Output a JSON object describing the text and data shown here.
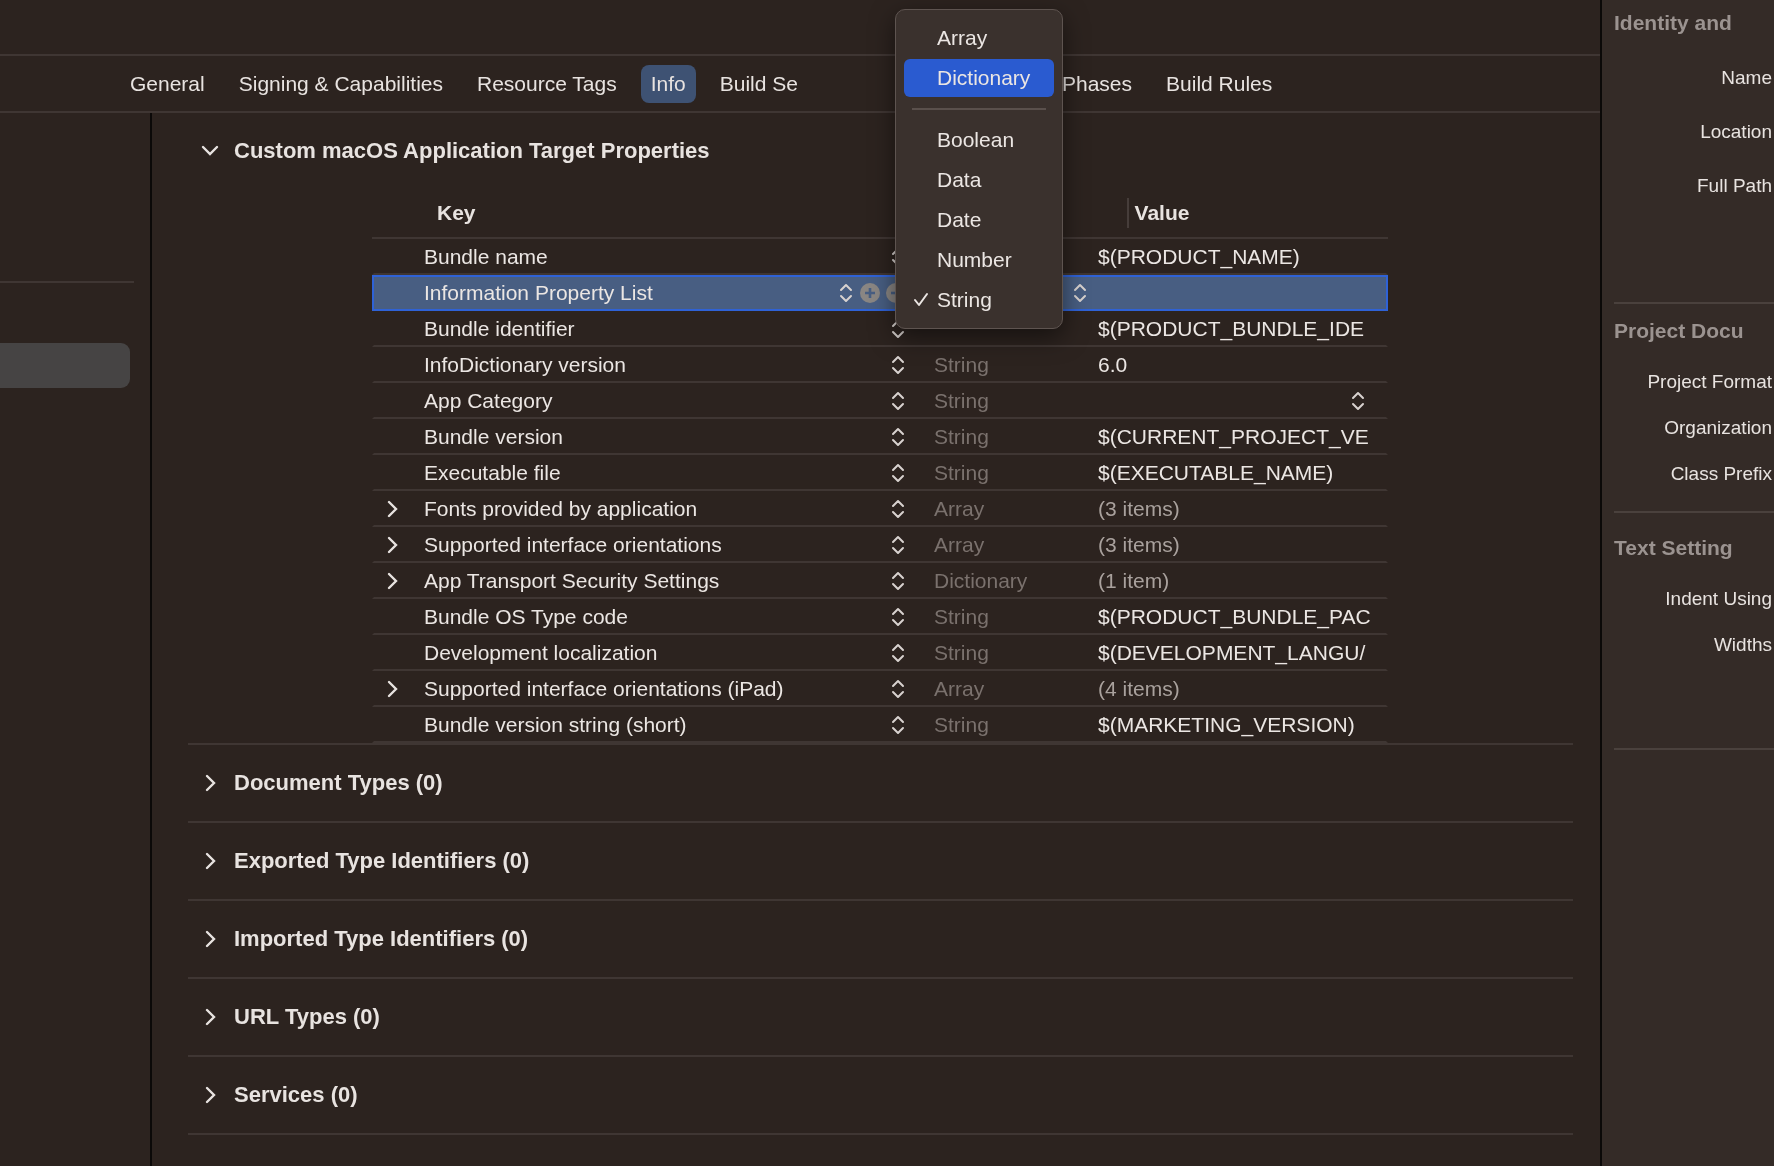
{
  "tabs": [
    {
      "label": "General",
      "selected": false
    },
    {
      "label": "Signing & Capabilities",
      "selected": false
    },
    {
      "label": "Resource Tags",
      "selected": false
    },
    {
      "label": "Info",
      "selected": true
    },
    {
      "label": "Build Se",
      "selected": false
    },
    {
      "label": "Phases",
      "selected": false
    },
    {
      "label": "Build Rules",
      "selected": false
    }
  ],
  "section": {
    "title": "Custom macOS Application Target Properties",
    "expanded": true
  },
  "table": {
    "columns": [
      "Key",
      "Value"
    ],
    "rows": [
      {
        "key": "Bundle name",
        "value": "$(PRODUCT_NAME)",
        "selected": false,
        "expandable": false
      },
      {
        "key": "Information Property List",
        "selected": true,
        "expandable": false
      },
      {
        "key": "Bundle identifier",
        "value": "$(PRODUCT_BUNDLE_IDE",
        "selected": false,
        "expandable": false
      },
      {
        "key": "InfoDictionary version",
        "type": "String",
        "value": "6.0",
        "selected": false,
        "expandable": false
      },
      {
        "key": "App Category",
        "type": "String",
        "selected": false,
        "expandable": false,
        "value_popup": true
      },
      {
        "key": "Bundle version",
        "type": "String",
        "value": "$(CURRENT_PROJECT_VE",
        "selected": false,
        "expandable": false
      },
      {
        "key": "Executable file",
        "type": "String",
        "value": "$(EXECUTABLE_NAME)",
        "selected": false,
        "expandable": false
      },
      {
        "key": "Fonts provided by application",
        "type": "Array",
        "value": "(3 items)",
        "selected": false,
        "expandable": true
      },
      {
        "key": "Supported interface orientations",
        "type": "Array",
        "value": "(3 items)",
        "selected": false,
        "expandable": true
      },
      {
        "key": "App Transport Security Settings",
        "type": "Dictionary",
        "value": "(1 item)",
        "selected": false,
        "expandable": true
      },
      {
        "key": "Bundle OS Type code",
        "type": "String",
        "value": "$(PRODUCT_BUNDLE_PAC",
        "selected": false,
        "expandable": false
      },
      {
        "key": "Development localization",
        "type": "String",
        "value": "$(DEVELOPMENT_LANGU/",
        "selected": false,
        "expandable": false
      },
      {
        "key": "Supported interface orientations (iPad)",
        "type": "Array",
        "value": "(4 items)",
        "selected": false,
        "expandable": true
      },
      {
        "key": "Bundle version string (short)",
        "type": "String",
        "value": "$(MARKETING_VERSION)",
        "selected": false,
        "expandable": false
      }
    ]
  },
  "sections": [
    {
      "title": "Document Types (0)",
      "expanded": false
    },
    {
      "title": "Exported Type Identifiers (0)",
      "expanded": false
    },
    {
      "title": "Imported Type Identifiers (0)",
      "expanded": false
    },
    {
      "title": "URL Types (0)",
      "expanded": false
    },
    {
      "title": "Services (0)",
      "expanded": false
    }
  ],
  "type_menu": {
    "items": [
      {
        "kind": "item",
        "label": "Array",
        "selected": false,
        "checked": false
      },
      {
        "kind": "item",
        "label": "Dictionary",
        "selected": true,
        "checked": false
      },
      {
        "kind": "separator"
      },
      {
        "kind": "item",
        "label": "Boolean",
        "selected": false,
        "checked": false
      },
      {
        "kind": "item",
        "label": "Data",
        "selected": false,
        "checked": false
      },
      {
        "kind": "item",
        "label": "Date",
        "selected": false,
        "checked": false
      },
      {
        "kind": "item",
        "label": "Number",
        "selected": false,
        "checked": false
      },
      {
        "kind": "item",
        "label": "String",
        "selected": false,
        "checked": true
      }
    ]
  },
  "inspector": {
    "sections": [
      {
        "title": "Identity and",
        "fields": [
          "Name",
          "Location",
          "Full Path"
        ]
      },
      {
        "title": "Project Docu",
        "fields": [
          "Project Format",
          "Organization",
          "Class Prefix"
        ]
      },
      {
        "title": "Text Setting",
        "fields": [
          "Indent Using",
          "Widths"
        ]
      }
    ]
  }
}
